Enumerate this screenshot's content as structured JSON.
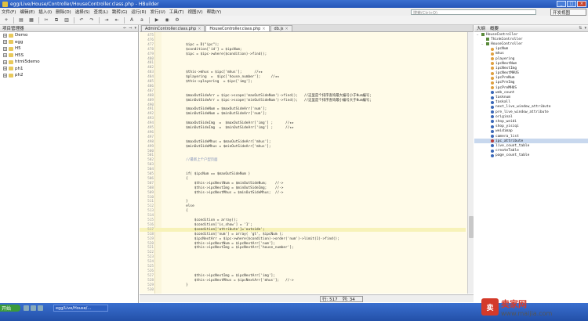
{
  "window": {
    "title": "egg/Live/House/Controller/HouseController.class.php - HBuilder",
    "controls": [
      "_",
      "□",
      "×"
    ]
  },
  "menu": [
    "文件(F)",
    "编辑(E)",
    "插入(I)",
    "删除(D)",
    "选择(S)",
    "查找(L)",
    "跳转(G)",
    "运行(R)",
    "发行(U)",
    "工具(T)",
    "视图(V)",
    "帮助(Y)"
  ],
  "search": {
    "placeholder": "搜索(Ctrl+Q)"
  },
  "view_button": "开发视图",
  "toolbar": {
    "icons": [
      "new-icon",
      "save-icon",
      "save-all-icon",
      "cut-icon",
      "copy-icon",
      "paste-icon",
      "undo-icon",
      "redo-icon",
      "indent-icon",
      "outdent-icon",
      "font-up-icon",
      "font-down-icon",
      "run-icon",
      "browser-icon",
      "settings-icon"
    ],
    "glyphs": [
      "+",
      "▤",
      "▦",
      "✂",
      "⧉",
      "▥",
      "↶",
      "↷",
      "⇥",
      "⇤",
      "A",
      "a",
      "▶",
      "◉",
      "⚙"
    ]
  },
  "left_panel": {
    "title": "项目管理器",
    "icons": [
      "⇐",
      "⇒",
      "▾"
    ],
    "items": [
      "Demo",
      "egg",
      "H5",
      "H5S",
      "html5demo",
      "ph1",
      "ph2"
    ]
  },
  "tabs": [
    {
      "label": "AdminController.class.php",
      "active": false
    },
    {
      "label": "HouseController.class.php",
      "active": true
    },
    {
      "label": "db.js",
      "active": false
    }
  ],
  "code": [
    {
      "ln": "475",
      "t": ""
    },
    {
      "ln": "476",
      "t": ""
    },
    {
      "ln": "477",
      "t": "        $ipc = D(\"ipc\");"
    },
    {
      "ln": "478",
      "t": "        $condition['id'] = $ipcNum;"
    },
    {
      "ln": "479",
      "t": "        $ipc = $ipc->where($condition)->find();"
    },
    {
      "ln": "480",
      "t": ""
    },
    {
      "ln": "481",
      "t": ""
    },
    {
      "ln": "482",
      "t": ""
    },
    {
      "ln": "483",
      "t": "        $this->mhus = $ipc['mhus'];      //★★"
    },
    {
      "ln": "484",
      "t": "        $playering  =  $ipc['house_number'];     //★★"
    },
    {
      "ln": "485",
      "t": "        $this->playering  = $ipc['img'];"
    },
    {
      "ln": "486",
      "t": ""
    },
    {
      "ln": "487",
      "t": ""
    },
    {
      "ln": "488",
      "t": "        $maxOutSideArr = $ipc->scope('maxOutSideNum')->find();   //这里是个排序查询最大编号小于Num编号；"
    },
    {
      "ln": "489",
      "t": "        $minOutSideArr = $ipc->scope('minOutSideNum')->find();   //这里是个排序查询最小编号大于Num编号；"
    },
    {
      "ln": "490",
      "t": ""
    },
    {
      "ln": "491",
      "t": "        $maxOutSideNum = $maxOutSideArr['num'];"
    },
    {
      "ln": "492",
      "t": "        $minOutSideNum = $minOutSideArr['num'];"
    },
    {
      "ln": "493",
      "t": ""
    },
    {
      "ln": "494",
      "t": "        $maxOutSideImg  =  $maxOutSideArr['img'] ;      //★★"
    },
    {
      "ln": "495",
      "t": "        $minOutSideImg  =  $minOutSideArr['img'] ;      //★★"
    },
    {
      "ln": "496",
      "t": ""
    },
    {
      "ln": "497",
      "t": ""
    },
    {
      "ln": "498",
      "t": "        $maxOutSideMhus = $maxOutSideArr['mhus'];"
    },
    {
      "ln": "499",
      "t": "        $minOutSideMhus = $minOutSideArr['mhus'];"
    },
    {
      "ln": "500",
      "t": ""
    },
    {
      "ln": "501",
      "t": ""
    },
    {
      "ln": "502",
      "t": "        //最新上个户型页面"
    },
    {
      "ln": "503",
      "t": ""
    },
    {
      "ln": "504",
      "t": ""
    },
    {
      "ln": "505",
      "t": "        if( $ipcNum == $maxOutSideNum )"
    },
    {
      "ln": "506",
      "t": "        {"
    },
    {
      "ln": "507",
      "t": "            $this->ipcNextNum = $minOutSideNum;    //->"
    },
    {
      "ln": "508",
      "t": "            $this->ipcNextImg = $minOutSideImg;    //->"
    },
    {
      "ln": "509",
      "t": "            $this->ipcNextMhus = $minOutSideMhus;  //->"
    },
    {
      "ln": "510",
      "t": ""
    },
    {
      "ln": "511",
      "t": "        }"
    },
    {
      "ln": "512",
      "t": "        else"
    },
    {
      "ln": "513",
      "t": "        {"
    },
    {
      "ln": "514",
      "t": ""
    },
    {
      "ln": "515",
      "t": "            $condition = array();"
    },
    {
      "ln": "516",
      "t": "            $condition['is_show'] = '1';"
    },
    {
      "ln": "517",
      "t": "            $condition['attribute']='outside';"
    },
    {
      "ln": "518",
      "t": "            $condition['num'] = array( 'gt', $ipcNum );"
    },
    {
      "ln": "519",
      "t": "            $ipcNextArr = $ipc->where($condition)->order('num')->limit(1)->find();"
    },
    {
      "ln": "520",
      "t": "            $this->ipcNextNum = $ipcNextArr['num'];"
    },
    {
      "ln": "521",
      "t": "            $this->ipcNextImg = $ipcNextArr['house_number'];"
    },
    {
      "ln": "522",
      "t": ""
    },
    {
      "ln": "523",
      "t": ""
    },
    {
      "ln": "524",
      "t": ""
    },
    {
      "ln": "525",
      "t": ""
    },
    {
      "ln": "526",
      "t": ""
    },
    {
      "ln": "527",
      "t": "            $this->ipcNextImg = $ipcNextArr['img'];"
    },
    {
      "ln": "528",
      "t": "            $this->ipcNextMhus = $ipcNextArr['mhus'];   //->"
    },
    {
      "ln": "529",
      "t": "        }"
    },
    {
      "ln": "530",
      "t": ""
    }
  ],
  "status": {
    "row": "行: 517",
    "col": "列: 34"
  },
  "outline": {
    "tabs": [
      "大纲",
      "概要"
    ],
    "icons": [
      "⇅",
      "▾"
    ],
    "items": [
      {
        "label": "HouseController",
        "kind": "class",
        "indent": 0,
        "tw": "−"
      },
      {
        "label": "ThinkController",
        "kind": "class",
        "indent": 1,
        "tw": ""
      },
      {
        "label": "HouseController",
        "kind": "class",
        "indent": 1,
        "tw": "−"
      },
      {
        "label": "ipcNum",
        "kind": "var",
        "indent": 2,
        "tw": ""
      },
      {
        "label": "mhus",
        "kind": "var",
        "indent": 2,
        "tw": ""
      },
      {
        "label": "playering",
        "kind": "var",
        "indent": 2,
        "tw": ""
      },
      {
        "label": "ipcNextNum",
        "kind": "var",
        "indent": 2,
        "tw": ""
      },
      {
        "label": "ipcNextImg",
        "kind": "var",
        "indent": 2,
        "tw": ""
      },
      {
        "label": "ipcNextMHUS",
        "kind": "var",
        "indent": 2,
        "tw": ""
      },
      {
        "label": "ipcPreNum",
        "kind": "var",
        "indent": 2,
        "tw": ""
      },
      {
        "label": "ipcPreImg",
        "kind": "var",
        "indent": 2,
        "tw": ""
      },
      {
        "label": "ipcPreMHUS",
        "kind": "var",
        "indent": 2,
        "tw": ""
      },
      {
        "label": "web_count",
        "kind": "fn",
        "indent": 2,
        "tw": ""
      },
      {
        "label": "tasknum",
        "kind": "fn",
        "indent": 2,
        "tw": ""
      },
      {
        "label": "taskall",
        "kind": "fn",
        "indent": 2,
        "tw": ""
      },
      {
        "label": "next_live_window_attribute",
        "kind": "fn",
        "indent": 2,
        "tw": ""
      },
      {
        "label": "pre_live_window_attribute",
        "kind": "fn",
        "indent": 2,
        "tw": ""
      },
      {
        "label": "original",
        "kind": "fn",
        "indent": 2,
        "tw": ""
      },
      {
        "label": "shop_weidi",
        "kind": "fn",
        "indent": 2,
        "tw": ""
      },
      {
        "label": "shop_yisiqi",
        "kind": "fn",
        "indent": 2,
        "tw": ""
      },
      {
        "label": "weidimap",
        "kind": "fn",
        "indent": 2,
        "tw": ""
      },
      {
        "label": "camera_list",
        "kind": "fn",
        "indent": 2,
        "tw": ""
      },
      {
        "label": "ipc_attribute",
        "kind": "sel",
        "indent": 2,
        "tw": "",
        "selected": true
      },
      {
        "label": "live_count_table",
        "kind": "fn",
        "indent": 2,
        "tw": ""
      },
      {
        "label": "createTable",
        "kind": "fn",
        "indent": 2,
        "tw": ""
      },
      {
        "label": "page_count_table",
        "kind": "fn",
        "indent": 2,
        "tw": ""
      }
    ]
  },
  "taskbar": {
    "start": "开始",
    "task": "egg/Live/House/..."
  },
  "watermark": {
    "brand": "卖家网",
    "url": "www.maijia.com"
  }
}
